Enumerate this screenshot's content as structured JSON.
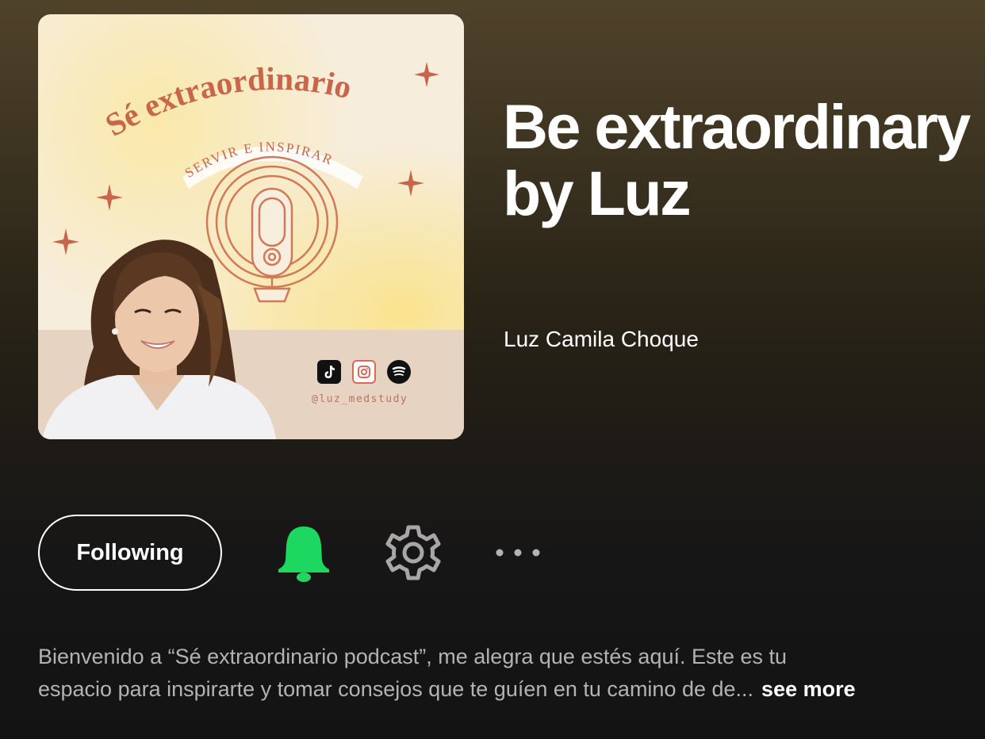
{
  "cover": {
    "title_text": "Sé extraordinario",
    "subtitle_text": "SERVIR E INSPIRAR",
    "social_icons": [
      "tiktok-icon",
      "instagram-icon",
      "spotify-icon"
    ],
    "handle": "@luz_medstudy",
    "colors": {
      "accent": "#c8664c",
      "band": "#e7d3c2"
    }
  },
  "show": {
    "title": "Be extraordinary by Luz",
    "author": "Luz Camila Choque"
  },
  "actions": {
    "follow_label": "Following",
    "bell_icon": "bell-icon",
    "settings_icon": "gear-icon",
    "more_icon": "more-icon",
    "bell_color": "#1ed760"
  },
  "description": {
    "line1": "Bienvenido a “Sé extraordinario podcast”, me alegra que estés aquí. Este es tu",
    "line2": "espacio para inspirarte y tomar consejos que te guíen en tu camino de de...",
    "see_more": "see more"
  }
}
